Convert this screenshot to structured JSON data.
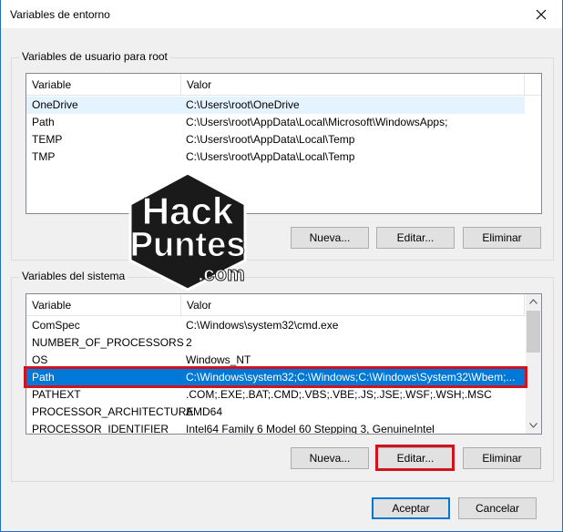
{
  "window": {
    "title": "Variables de entorno"
  },
  "user_vars": {
    "group_title": "Variables de usuario para root",
    "columns": [
      "Variable",
      "Valor"
    ],
    "rows": [
      {
        "name": "OneDrive",
        "value": "C:\\Users\\root\\OneDrive"
      },
      {
        "name": "Path",
        "value": "C:\\Users\\root\\AppData\\Local\\Microsoft\\WindowsApps;"
      },
      {
        "name": "TEMP",
        "value": "C:\\Users\\root\\AppData\\Local\\Temp"
      },
      {
        "name": "TMP",
        "value": "C:\\Users\\root\\AppData\\Local\\Temp"
      }
    ],
    "buttons": {
      "new": "Nueva...",
      "edit": "Editar...",
      "delete": "Eliminar"
    }
  },
  "system_vars": {
    "group_title": "Variables del sistema",
    "columns": [
      "Variable",
      "Valor"
    ],
    "rows": [
      {
        "name": "ComSpec",
        "value": "C:\\Windows\\system32\\cmd.exe"
      },
      {
        "name": "NUMBER_OF_PROCESSORS",
        "value": "2"
      },
      {
        "name": "OS",
        "value": "Windows_NT"
      },
      {
        "name": "Path",
        "value": "C:\\Windows\\system32;C:\\Windows;C:\\Windows\\System32\\Wbem;..."
      },
      {
        "name": "PATHEXT",
        "value": ".COM;.EXE;.BAT;.CMD;.VBS;.VBE;.JS;.JSE;.WSF;.WSH;.MSC"
      },
      {
        "name": "PROCESSOR_ARCHITECTURE",
        "value": "AMD64"
      },
      {
        "name": "PROCESSOR_IDENTIFIER",
        "value": "Intel64 Family 6 Model 60 Stepping 3, GenuineIntel"
      }
    ],
    "buttons": {
      "new": "Nueva...",
      "edit": "Editar...",
      "delete": "Eliminar"
    }
  },
  "footer": {
    "accept": "Aceptar",
    "cancel": "Cancelar"
  },
  "watermark": {
    "line1": "Hack",
    "line2": "Puntes",
    "line3": ".com"
  }
}
